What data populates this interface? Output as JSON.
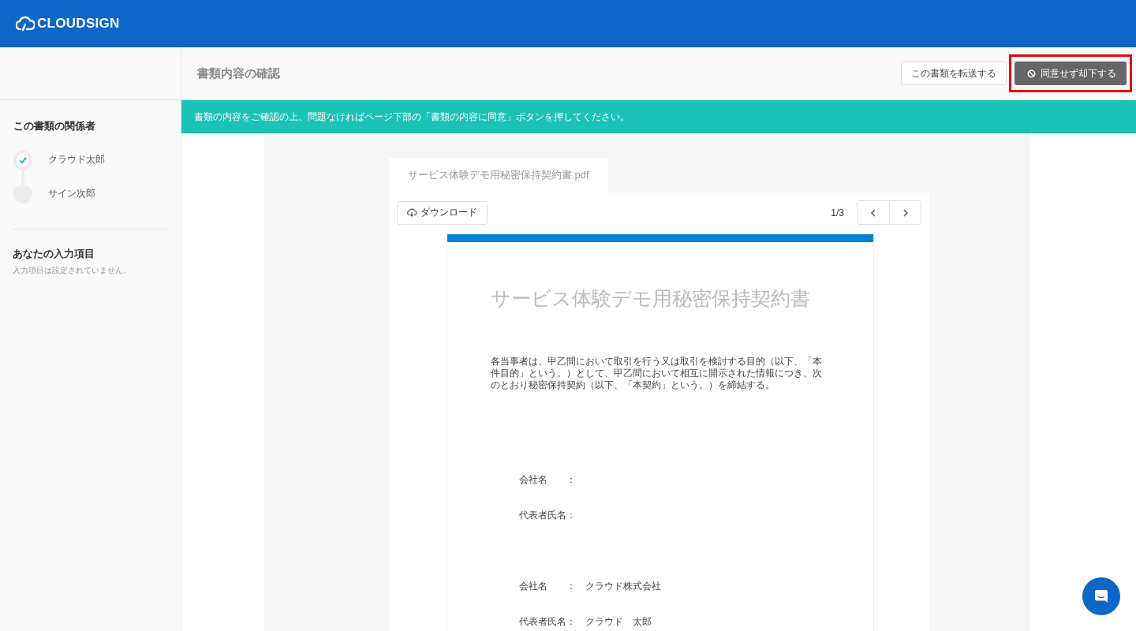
{
  "header": {
    "logo": "CLOUDSIGN"
  },
  "sidebar": {
    "participants_title": "この書類の関係者",
    "participants": [
      {
        "name": "クラウド太郎",
        "signed": true
      },
      {
        "name": "サイン次郎",
        "signed": false
      }
    ],
    "inputs_title": "あなたの入力項目",
    "inputs_note": "入力項目は設定されていません。"
  },
  "toolbar": {
    "title": "書類内容の確認",
    "buttons": [
      {
        "label": "この書類を転送する",
        "kind": "secondary",
        "highlighted": false
      },
      {
        "label": "同意せず却下する",
        "kind": "reject",
        "highlighted": true
      }
    ]
  },
  "notice": "書類の内容をご確認の上、問題なければページ下部の「書類の内容に同意」ボタンを押してください。",
  "viewer": {
    "tab": "サービス体験デモ用秘密保持契約書.pdf",
    "download": "ダウンロード",
    "page_indicator": "1/3",
    "document": {
      "title": "サービス体験デモ用秘密保持契約書",
      "body": "各当事者は、甲乙間において取引を行う又は取引を検討する目的（以下、「本件目的」という。）として、甲乙間において相互に開示された情報につき、次のとおり秘密保持契約（以下、「本契約」という。）を締結する。",
      "parties": [
        {
          "fields": [
            {
              "label": "会社名",
              "separator": "："
            },
            {
              "label": "代表者氏名",
              "separator": "："
            }
          ]
        },
        {
          "fields": [
            {
              "label": "会社名",
              "separator": "：",
              "value": "クラウド株式会社"
            },
            {
              "label": "代表者氏名",
              "separator": "：",
              "value": "クラウド　太郎"
            }
          ]
        }
      ]
    }
  }
}
